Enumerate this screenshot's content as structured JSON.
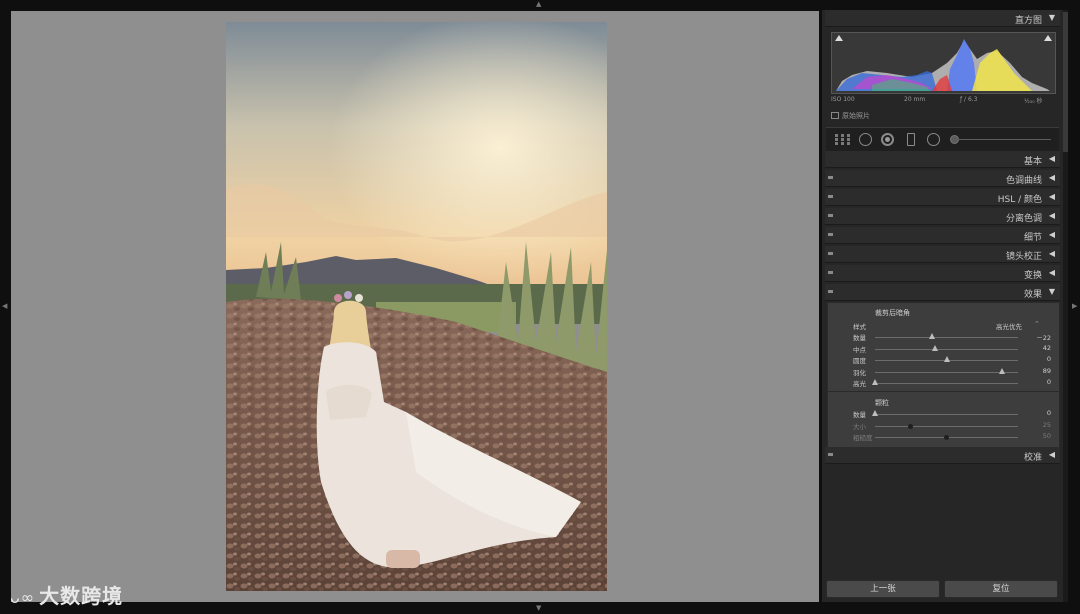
{
  "panel": {
    "histogram_title": "直方图",
    "exif": {
      "iso": "ISO 100",
      "focal": "20 mm",
      "aperture": "ƒ / 6.3",
      "shutter": "¹⁄₂₅₀ 秒"
    },
    "original_photo_label": "原始照片",
    "sections": {
      "basic": "基本",
      "tone_curve": "色调曲线",
      "hsl": "HSL / 颜色",
      "split_toning": "分离色调",
      "detail": "细节",
      "lens_correction": "镜头校正",
      "transform": "变换",
      "effects": "效果",
      "calibration": "校准"
    }
  },
  "effects": {
    "vignette_title": "裁剪后暗角",
    "style_label": "样式",
    "style_value": "高光优先",
    "rows": [
      {
        "label": "数量",
        "value": "－22",
        "level": 0.4
      },
      {
        "label": "中点",
        "value": "42",
        "level": 0.42
      },
      {
        "label": "圆度",
        "value": "0",
        "level": 0.5
      },
      {
        "label": "羽化",
        "value": "89",
        "level": 0.89
      },
      {
        "label": "高光",
        "value": "0",
        "level": 0.0
      }
    ],
    "grain_title": "颗粒",
    "grain_rows": [
      {
        "label": "数量",
        "value": "0",
        "level": 0.0,
        "dim": false
      },
      {
        "label": "大小",
        "value": "25",
        "level": 0.25,
        "dim": true
      },
      {
        "label": "粗糙度",
        "value": "50",
        "level": 0.5,
        "dim": true
      }
    ]
  },
  "buttons": {
    "previous": "上一张",
    "reset": "复位"
  },
  "watermark": {
    "logo": "ᴗ∞",
    "text": "大数跨境"
  },
  "colors": {
    "panel": "#262626",
    "canvas": "#8f8f8f",
    "header": "#2c2c2c"
  }
}
